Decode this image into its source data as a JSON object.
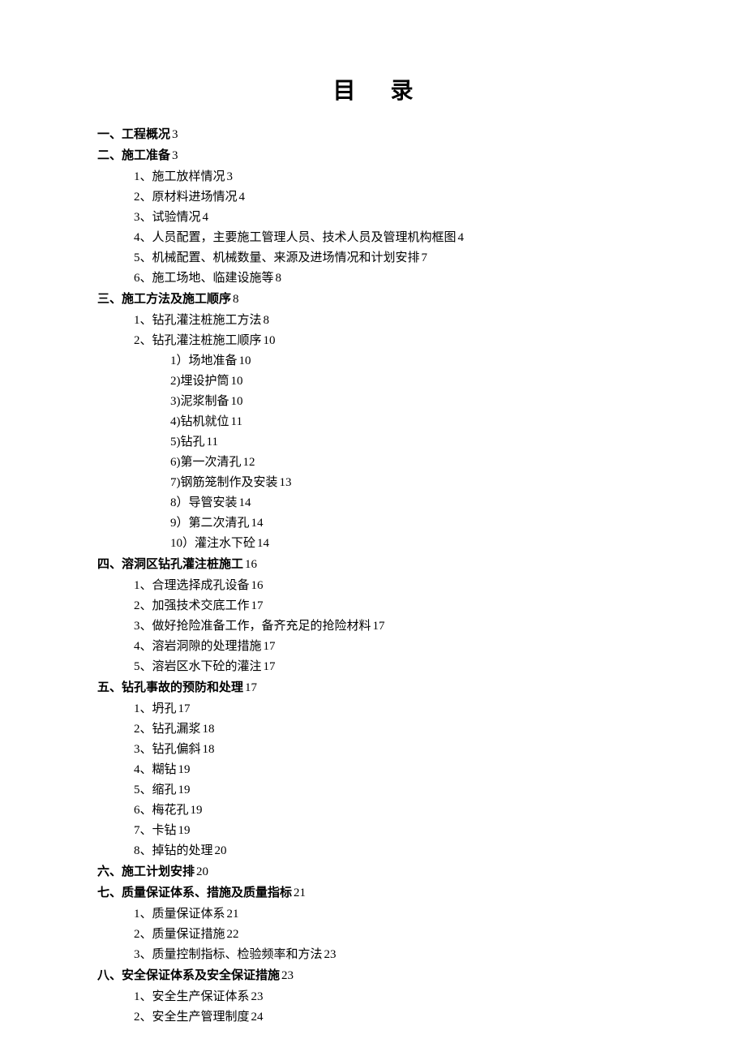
{
  "title": "目 录",
  "toc": [
    {
      "level": 1,
      "text": "一、工程概况",
      "page": "3"
    },
    {
      "level": 1,
      "text": "二、施工准备",
      "page": "3"
    },
    {
      "level": 2,
      "text": "1、施工放样情况",
      "page": "3"
    },
    {
      "level": 2,
      "text": "2、原材料进场情况",
      "page": "4"
    },
    {
      "level": 2,
      "text": "3、试验情况",
      "page": "4"
    },
    {
      "level": 2,
      "text": "4、人员配置，主要施工管理人员、技术人员及管理机构框图",
      "page": "4"
    },
    {
      "level": 2,
      "text": "5、机械配置、机械数量、来源及进场情况和计划安排",
      "page": "7"
    },
    {
      "level": 2,
      "text": "6、施工场地、临建设施等",
      "page": "8"
    },
    {
      "level": 1,
      "text": "三、施工方法及施工顺序",
      "page": "8"
    },
    {
      "level": 2,
      "text": "1、钻孔灌注桩施工方法",
      "page": "8"
    },
    {
      "level": 2,
      "text": "2、钻孔灌注桩施工顺序",
      "page": "10"
    },
    {
      "level": 3,
      "text": "1）场地准备",
      "page": "10"
    },
    {
      "level": 3,
      "text": "2)埋设护筒",
      "page": "10"
    },
    {
      "level": 3,
      "text": "3)泥浆制备",
      "page": "10"
    },
    {
      "level": 3,
      "text": "4)钻机就位",
      "page": "11"
    },
    {
      "level": 3,
      "text": "5)钻孔",
      "page": "11"
    },
    {
      "level": 3,
      "text": "6)第一次清孔",
      "page": "12"
    },
    {
      "level": 3,
      "text": "7)钢筋笼制作及安装",
      "page": "13"
    },
    {
      "level": 3,
      "text": "8）导管安装",
      "page": "14"
    },
    {
      "level": 3,
      "text": "9）第二次清孔",
      "page": "14"
    },
    {
      "level": 3,
      "text": "10）灌注水下砼",
      "page": "14"
    },
    {
      "level": 1,
      "text": "四、溶洞区钻孔灌注桩施工",
      "page": "16"
    },
    {
      "level": 2,
      "text": "1、合理选择成孔设备",
      "page": "16"
    },
    {
      "level": 2,
      "text": "2、加强技术交底工作",
      "page": "17"
    },
    {
      "level": 2,
      "text": "3、做好抢险准备工作，备齐充足的抢险材料",
      "page": "17"
    },
    {
      "level": 2,
      "text": "4、溶岩洞隙的处理措施",
      "page": "17"
    },
    {
      "level": 2,
      "text": "5、溶岩区水下砼的灌注",
      "page": "17"
    },
    {
      "level": 1,
      "text": "五、钻孔事故的预防和处理",
      "page": "17"
    },
    {
      "level": 2,
      "text": "1、坍孔",
      "page": "17"
    },
    {
      "level": 2,
      "text": "2、钻孔漏浆",
      "page": "18"
    },
    {
      "level": 2,
      "text": "3、钻孔偏斜",
      "page": "18"
    },
    {
      "level": 2,
      "text": "4、糊钻",
      "page": "19"
    },
    {
      "level": 2,
      "text": "5、缩孔",
      "page": "19"
    },
    {
      "level": 2,
      "text": "6、梅花孔",
      "page": "19"
    },
    {
      "level": 2,
      "text": "7、卡钻",
      "page": "19"
    },
    {
      "level": 2,
      "text": "8、掉钻的处理",
      "page": "20"
    },
    {
      "level": 1,
      "text": "六、施工计划安排",
      "page": "20"
    },
    {
      "level": 1,
      "text": "七、质量保证体系、措施及质量指标",
      "page": "21"
    },
    {
      "level": 2,
      "text": "1、质量保证体系",
      "page": "21"
    },
    {
      "level": 2,
      "text": "2、质量保证措施",
      "page": "22"
    },
    {
      "level": 2,
      "text": "3、质量控制指标、检验频率和方法",
      "page": "23"
    },
    {
      "level": 1,
      "text": "八、安全保证体系及安全保证措施",
      "page": "23"
    },
    {
      "level": 2,
      "text": "1、安全生产保证体系",
      "page": "23"
    },
    {
      "level": 2,
      "text": "2、安全生产管理制度",
      "page": "24"
    }
  ]
}
